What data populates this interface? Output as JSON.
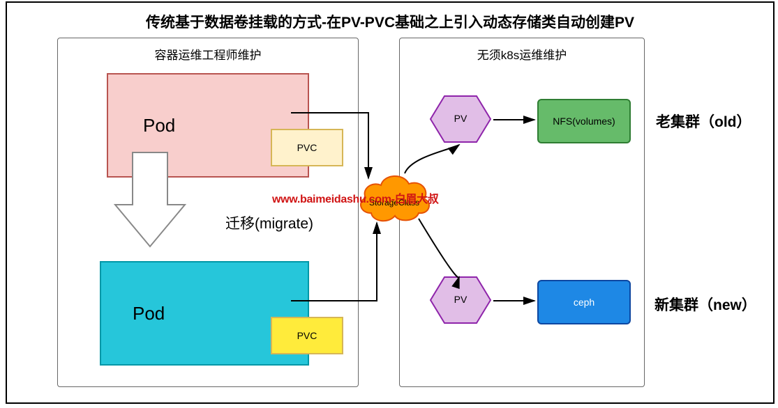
{
  "title": "传统基于数据卷挂载的方式-在PV-PVC基础之上引入动态存储类自动创建PV",
  "left_group": {
    "label": "容器运维工程师维护"
  },
  "right_group": {
    "label": "无须k8s运维维护"
  },
  "pod1": {
    "label": "Pod"
  },
  "pod2": {
    "label": "Pod"
  },
  "pvc1": {
    "label": "PVC"
  },
  "pvc2": {
    "label": "PVC"
  },
  "migrate": "迁移(migrate)",
  "storage_class": "StorageClass",
  "pv1": {
    "label": "PV"
  },
  "pv2": {
    "label": "PV"
  },
  "nfs": {
    "label": "NFS(volumes)"
  },
  "ceph": {
    "label": "ceph"
  },
  "old_cluster": "老集群（old）",
  "new_cluster": "新集群（new）",
  "watermark": "www.baimeidashu.com-白眉大叔"
}
